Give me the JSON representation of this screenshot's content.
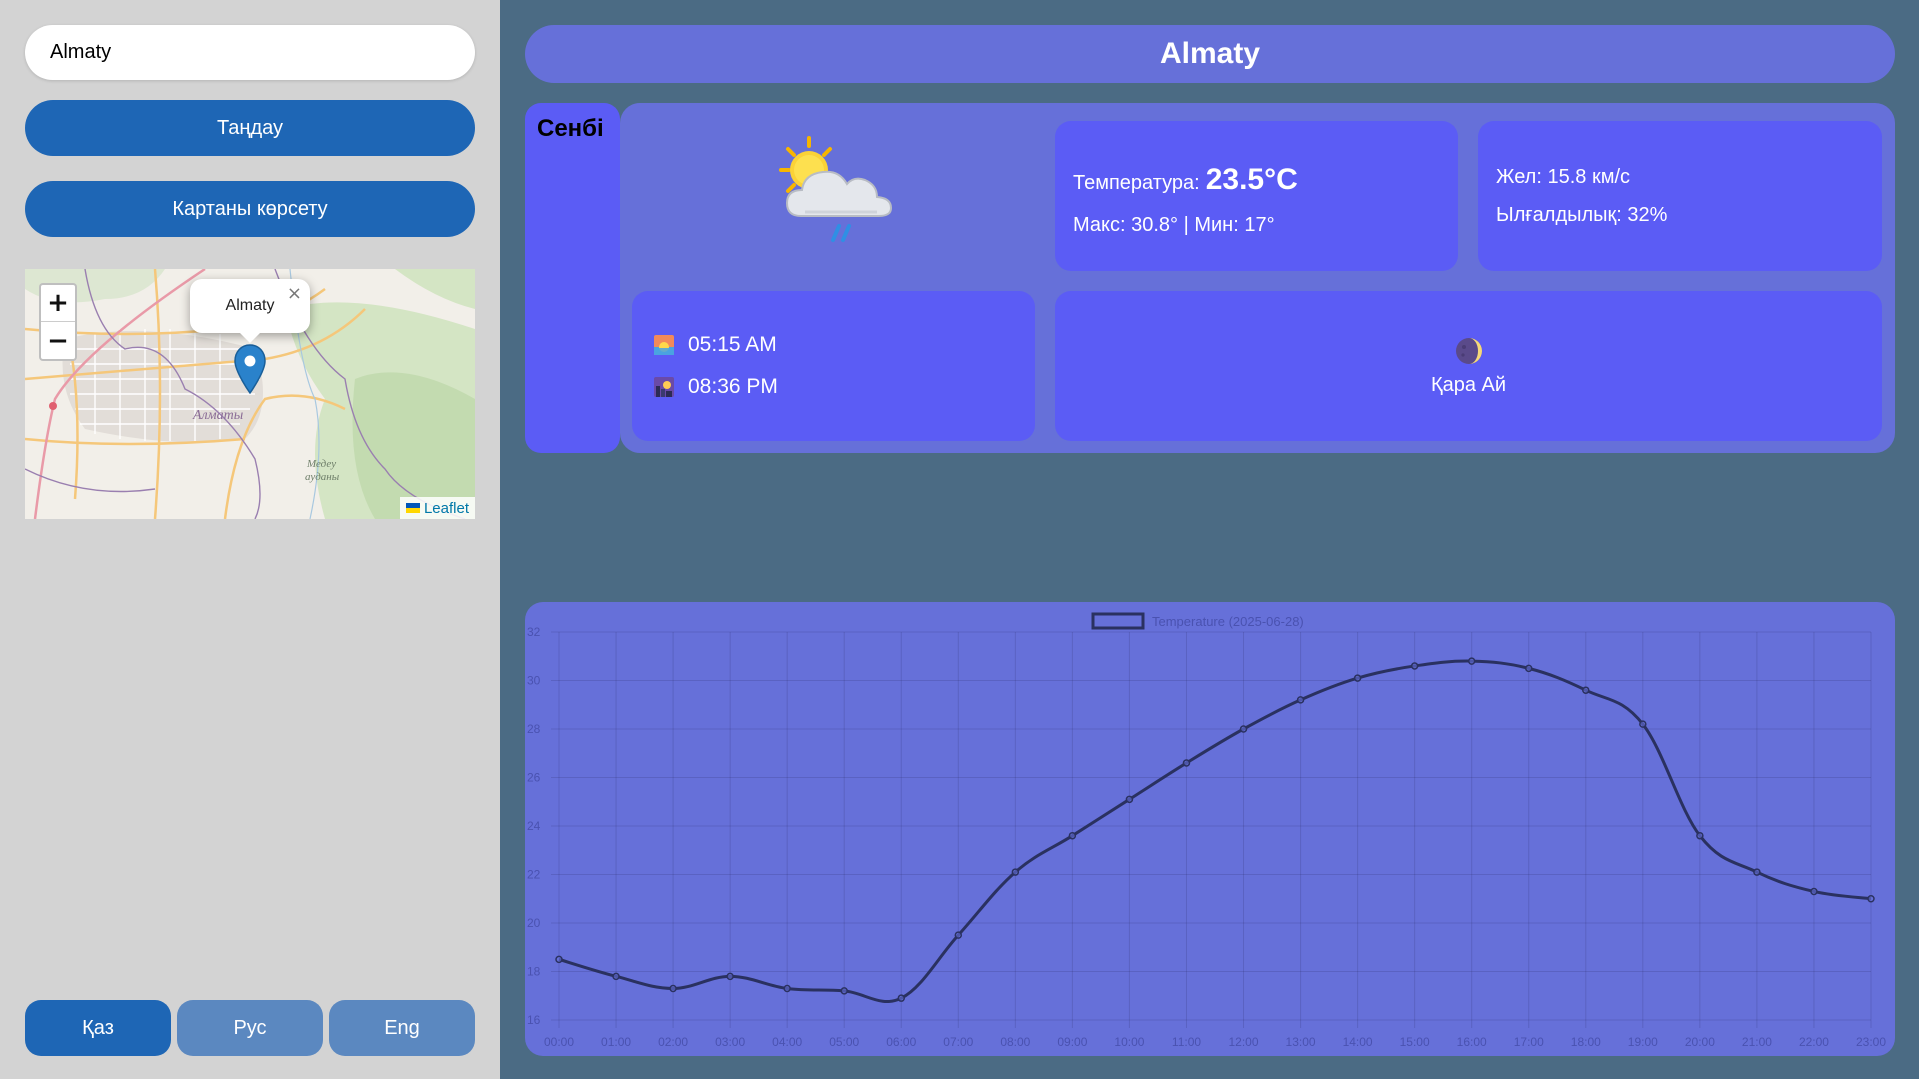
{
  "sidebar": {
    "city_input_value": "Almaty",
    "select_button": "Таңдау",
    "map_button": "Картаны көрсету",
    "map": {
      "popup_label": "Almaty",
      "popup_close": "×",
      "zoom_in": "+",
      "zoom_out": "−",
      "attribution": "Leaflet",
      "map_labels": [
        "Алматы",
        "Медеу",
        "ауданы"
      ]
    },
    "languages": [
      "Қаз",
      "Рус",
      "Eng"
    ],
    "active_language": "Қаз"
  },
  "main": {
    "city_title": "Almaty",
    "day_label": "Сенбі",
    "weather_icon": "sun-behind-rain-cloud-icon",
    "temperature_label": "Температура:",
    "temperature_value": "23.5°C",
    "max_min": "Макс: 30.8° | Мин: 17°",
    "wind": "Жел: 15.8 км/с",
    "humidity": "Ылғалдылық: 32%",
    "sunrise": "05:15 AM",
    "sunset": "08:36 PM",
    "moon_icon": "moon-phase-icon",
    "moon_phase": "Қара Ай"
  },
  "colors": {
    "accent": "#1e66b5",
    "card": "#5b5cf5",
    "panel": "#6670d9",
    "background": "#4b6b84",
    "sidebar": "#d3d3d3",
    "line": "#2a3160"
  },
  "chart_data": {
    "type": "line",
    "title": "",
    "legend": "Temperature (2025-06-28)",
    "legend_position": "top-center",
    "xlabel": "",
    "ylabel": "",
    "x": [
      "00:00",
      "01:00",
      "02:00",
      "03:00",
      "04:00",
      "05:00",
      "06:00",
      "07:00",
      "08:00",
      "09:00",
      "10:00",
      "11:00",
      "12:00",
      "13:00",
      "14:00",
      "15:00",
      "16:00",
      "17:00",
      "18:00",
      "19:00",
      "20:00",
      "21:00",
      "22:00",
      "23:00"
    ],
    "series": [
      {
        "name": "Temperature (2025-06-28)",
        "values": [
          18.5,
          17.8,
          17.3,
          17.8,
          17.3,
          17.2,
          16.9,
          19.5,
          22.1,
          23.6,
          25.1,
          26.6,
          28.0,
          29.2,
          30.1,
          30.6,
          30.8,
          30.5,
          29.6,
          28.2,
          23.6,
          22.1,
          21.3,
          21.0
        ]
      }
    ],
    "yticks": [
      16,
      18,
      20,
      22,
      24,
      26,
      28,
      30,
      32
    ],
    "ylim": [
      16,
      32
    ],
    "grid": true
  }
}
